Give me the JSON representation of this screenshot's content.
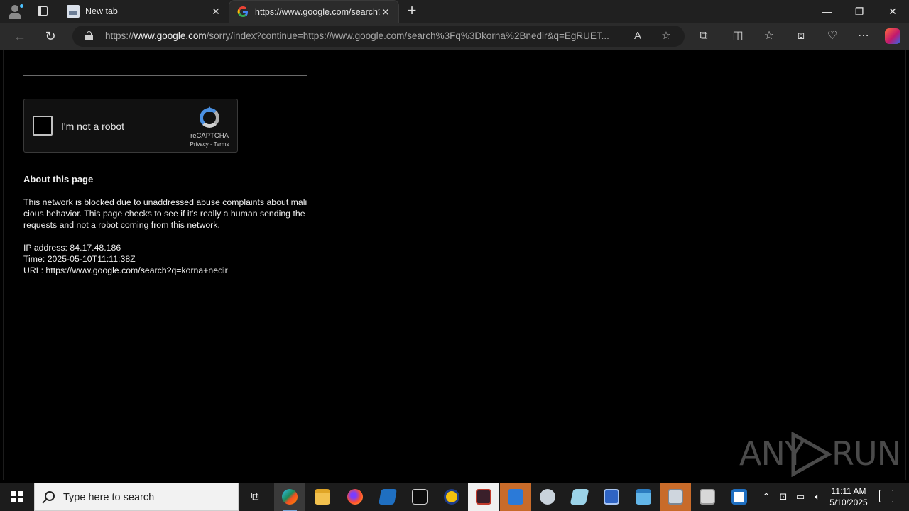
{
  "browser": {
    "tabs": [
      {
        "label": "New tab",
        "active": false
      },
      {
        "label": "https://www.google.com/search?q=korna+nedir",
        "active": true
      }
    ],
    "address": {
      "prefix": "https://",
      "host": "www.google.com",
      "path": "/sorry/index?continue=https://www.google.com/search%3Fq%3Dkorna%2Bnedir&q=EgRUET..."
    },
    "icons": {
      "read_aloud": "read-aloud-icon",
      "favorite": "star-icon",
      "extensions": "puzzle-icon",
      "split": "split-screen-icon",
      "favorites": "favorites-icon",
      "collections": "collections-icon",
      "performance": "heart-pulse-icon",
      "more": "more-icon"
    }
  },
  "page": {
    "captcha": {
      "label": "I'm not a robot",
      "brand": "reCAPTCHA",
      "links": "Privacy - Terms"
    },
    "about": {
      "title": "About this page",
      "text": "This network is blocked due to unaddressed abuse complaints about malicious behavior. This page checks to see if it's really a human sending the requests and not a robot coming from this network."
    },
    "ip_line": "IP address: 84.17.48.186",
    "time_line": "Time: 2025-05-10T11:11:38Z",
    "url_line": "URL: https://www.google.com/search?q=korna+nedir"
  },
  "watermark": {
    "left": "ANY",
    "right": "RUN"
  },
  "taskbar": {
    "search_placeholder": "Type here to search",
    "clock_time": "11:11 AM",
    "clock_date": "5/10/2025",
    "accent": "#7aa7d9"
  }
}
